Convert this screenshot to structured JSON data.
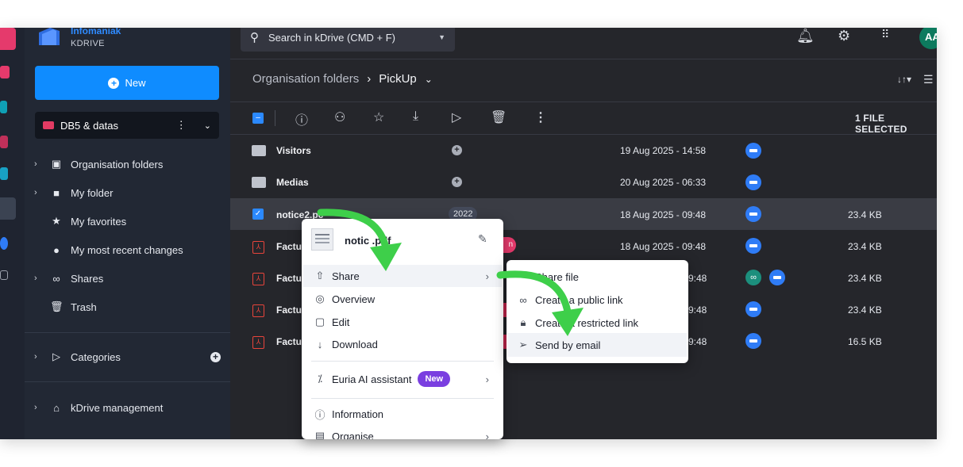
{
  "brand": {
    "name": "Infomaniak",
    "product": "KDRIVE"
  },
  "sidebar": {
    "new_label": "New",
    "drive_name": "DB5 & datas",
    "items": [
      {
        "label": "Organisation folders",
        "icon": "org-folder-icon"
      },
      {
        "label": "My folder",
        "icon": "folder-icon"
      },
      {
        "label": "My favorites",
        "icon": "star-icon"
      },
      {
        "label": "My most recent changes",
        "icon": "clock-icon"
      },
      {
        "label": "Shares",
        "icon": "link-icon"
      },
      {
        "label": "Trash",
        "icon": "trash-icon"
      }
    ],
    "categories_label": "Categories",
    "management_label": "kDrive management"
  },
  "header": {
    "search_placeholder": "Search in kDrive (CMD + F)",
    "avatar_initials": "AA"
  },
  "breadcrumb": {
    "parent": "Organisation folders",
    "current": "PickUp"
  },
  "toolbar": {
    "selected_count": "1 FILE SELECTED"
  },
  "files": [
    {
      "name": "Visitors",
      "date": "19 Aug 2025 - 14:58",
      "size": ""
    },
    {
      "name": "Medias",
      "date": "20 Aug 2025 - 06:33",
      "size": ""
    },
    {
      "name": "notice2.pc",
      "date": "18 Aug 2025 - 09:48",
      "size": "23.4 KB",
      "tag": "2022"
    },
    {
      "name": "Factu",
      "date": "18 Aug 2025 - 09:48",
      "size": "23.4 KB"
    },
    {
      "name": "Factu",
      "date": "9:48",
      "size": "23.4 KB"
    },
    {
      "name": "Factu",
      "date": "9:48",
      "size": "23.4 KB"
    },
    {
      "name": "Factu",
      "date": "9:48",
      "size": "16.5 KB"
    }
  ],
  "context_menu": {
    "file_name": "notic    .pdf",
    "items": {
      "share": "Share",
      "overview": "Overview",
      "edit": "Edit",
      "download": "Download",
      "ai": "Euria AI assistant",
      "ai_badge": "New",
      "information": "Information",
      "organise": "Organise"
    }
  },
  "share_menu": {
    "share_file": "Share file",
    "public_link": "Create a public link",
    "restricted_link": "Create a restricted link",
    "send_email": "Send by email"
  },
  "colors": {
    "accent": "#0f8cff",
    "arrow": "#3ecf4a",
    "sidebar": "#222834",
    "main": "#25262b"
  }
}
